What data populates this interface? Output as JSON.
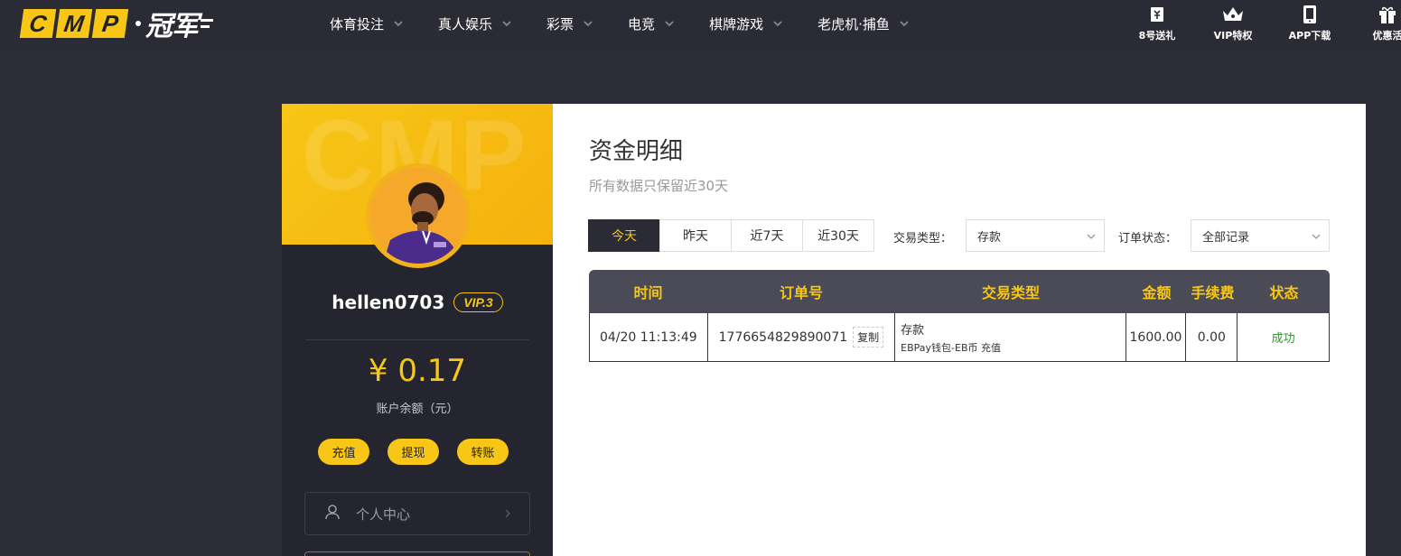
{
  "brand": {
    "logo_letters": [
      "C",
      "M",
      "P"
    ],
    "logo_cn": "冠军",
    "accent": "#f7c616",
    "dark": "#2b2b35"
  },
  "nav": {
    "items": [
      {
        "label": "体育投注"
      },
      {
        "label": "真人娱乐"
      },
      {
        "label": "彩票"
      },
      {
        "label": "电竞"
      },
      {
        "label": "棋牌游戏"
      },
      {
        "label": "老虎机·捕鱼"
      }
    ]
  },
  "quick_links": [
    {
      "label": "8号送礼",
      "icon": "ticket-icon"
    },
    {
      "label": "VIP特权",
      "icon": "crown-icon"
    },
    {
      "label": "APP下载",
      "icon": "tablet-icon"
    },
    {
      "label": "优惠活",
      "icon": "gift-icon"
    }
  ],
  "profile": {
    "watermark": "CMP",
    "username": "hellen0703",
    "vip": "VIP.3",
    "balance": "¥ 0.17",
    "balance_label": "账户余额（元）",
    "actions": [
      "充值",
      "提现",
      "转账"
    ],
    "menu_label": "个人中心"
  },
  "main": {
    "title": "资金明细",
    "subtitle": "所有数据只保留近30天",
    "tabs": [
      "今天",
      "昨天",
      "近7天",
      "近30天"
    ],
    "active_tab": "今天",
    "filter_type_label": "交易类型：",
    "filter_type_value": "存款",
    "filter_status_label": "订单状态：",
    "filter_status_value": "全部记录"
  },
  "table": {
    "headers": [
      "时间",
      "订单号",
      "交易类型",
      "金额",
      "手续费",
      "状态"
    ],
    "rows": [
      {
        "time": "04/20 11:13:49",
        "order_no": "1776654829890071",
        "copy_label": "复制",
        "type_main": "存款",
        "type_sub": "EBPay钱包-EB币 充值",
        "amount": "1600.00",
        "fee": "0.00",
        "status": "成功"
      }
    ]
  }
}
